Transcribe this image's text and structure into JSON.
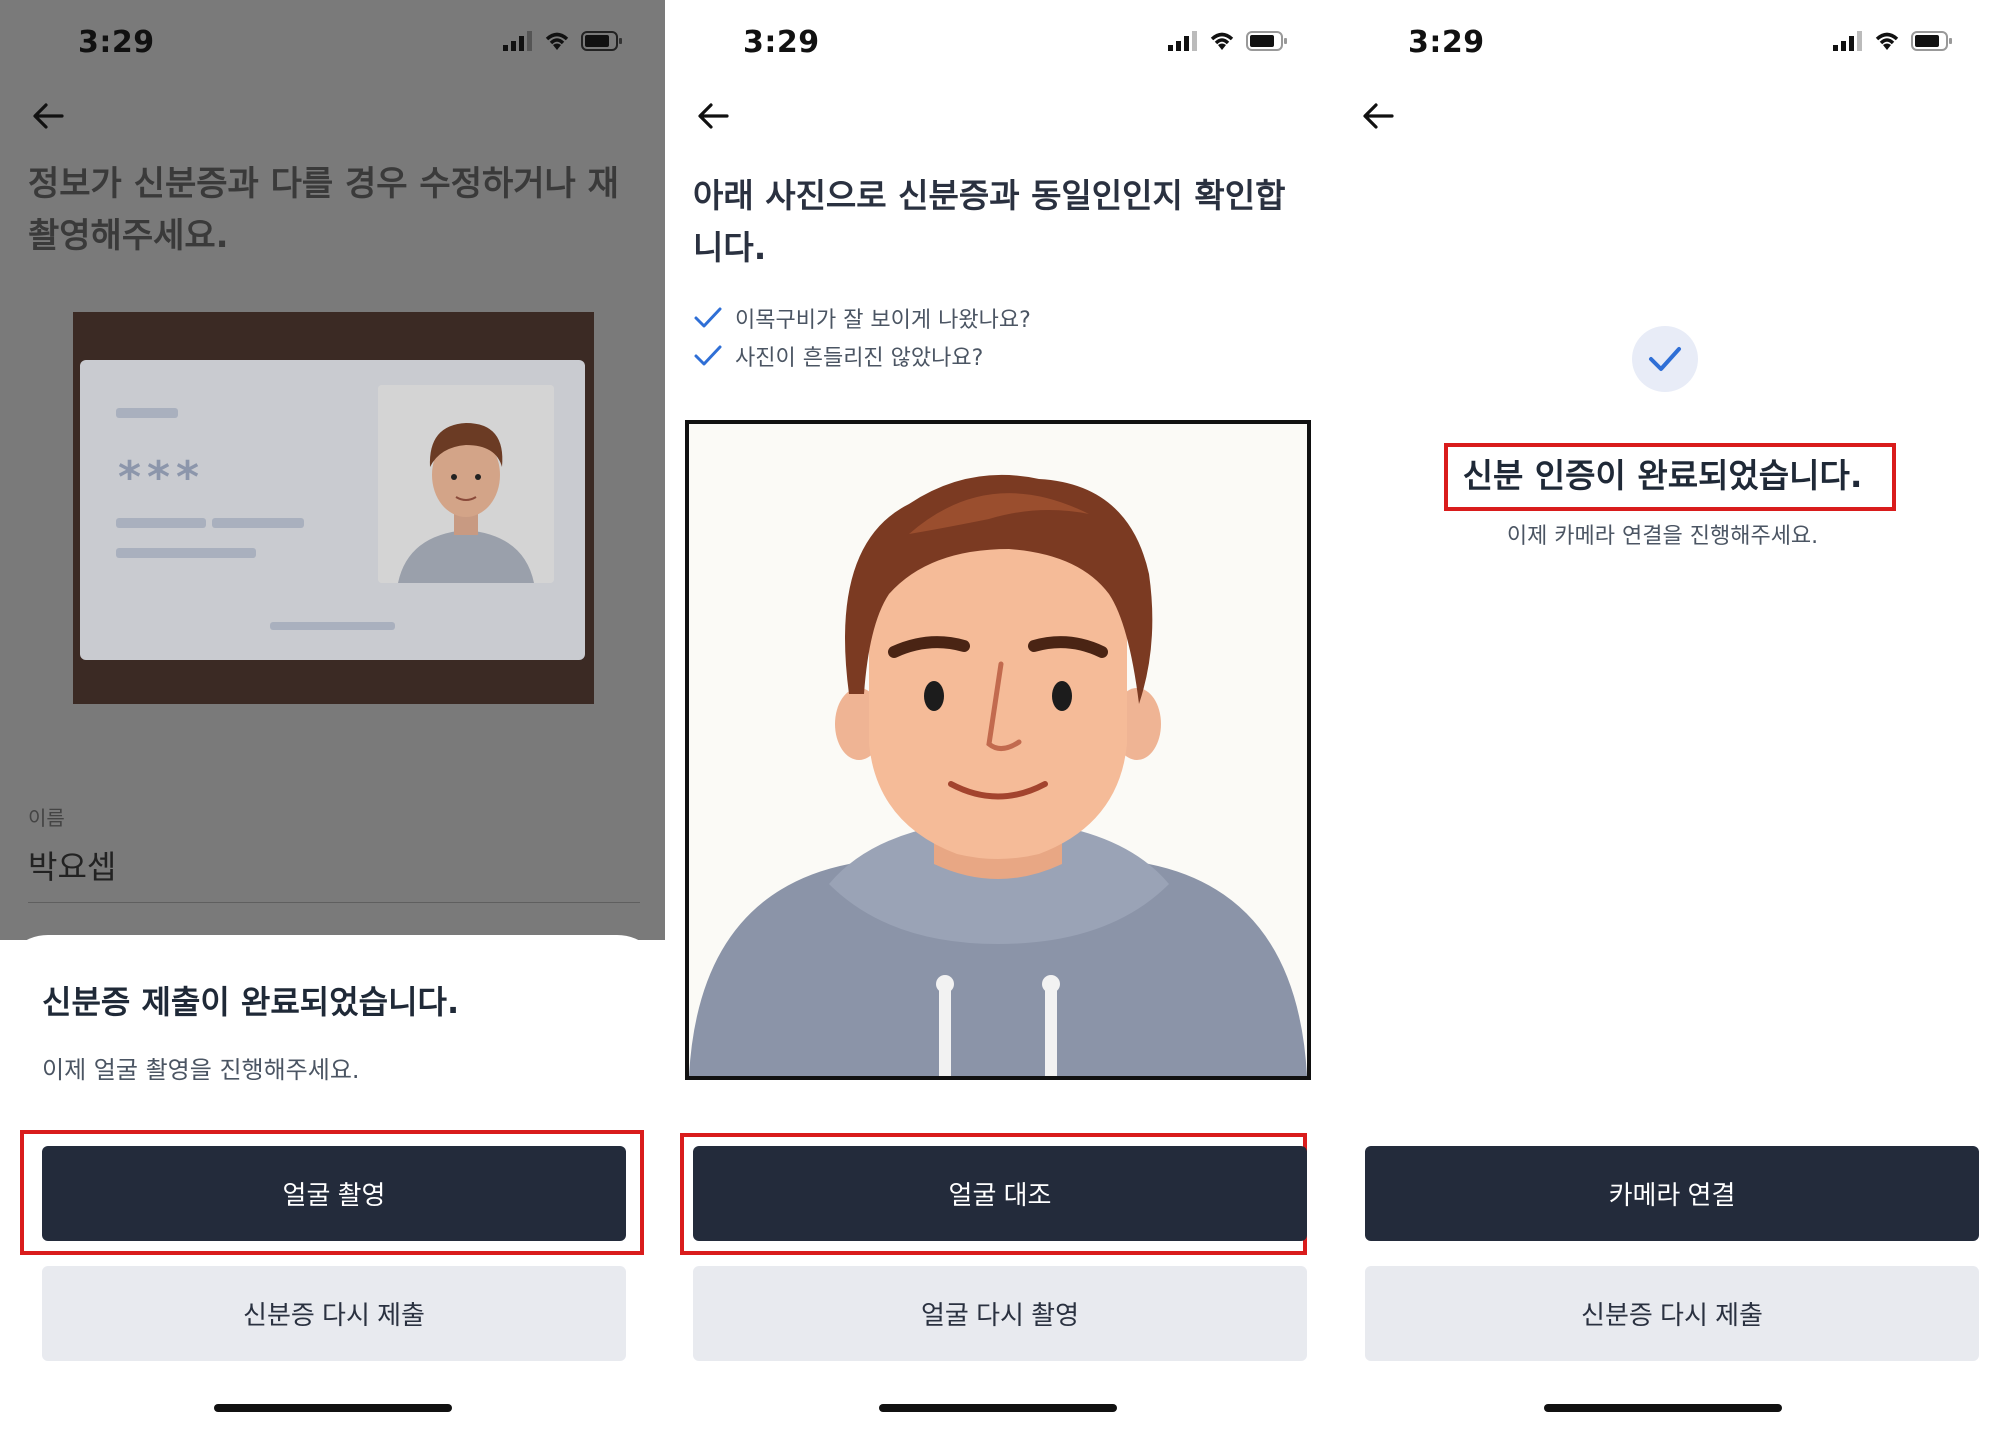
{
  "status": {
    "time": "3:29"
  },
  "screen1": {
    "title": "정보가 신분증과 다를 경우 수정하거나 재촬영해주세요.",
    "id_card_masked": "***",
    "name_label": "이름",
    "name_value": "박요셉",
    "sheet_title": "신분증 제출이 완료되었습니다.",
    "sheet_subtitle": "이제 얼굴 촬영을 진행해주세요.",
    "primary_button": "얼굴 촬영",
    "secondary_button": "신분증 다시 제출"
  },
  "screen2": {
    "title": "아래 사진으로 신분증과 동일인인지 확인합니다.",
    "checklist": [
      "이목구비가 잘 보이게 나왔나요?",
      "사진이 흔들리진 않았나요?"
    ],
    "primary_button": "얼굴 대조",
    "secondary_button": "얼굴 다시 촬영"
  },
  "screen3": {
    "title": "신분 인증이 완료되었습니다.",
    "subtitle": "이제 카메라 연결을 진행해주세요.",
    "primary_button": "카메라 연결",
    "secondary_button": "신분증 다시 제출"
  },
  "colors": {
    "primary": "#232b3b",
    "secondary": "#e8eaef",
    "highlight": "#d91c1c",
    "check": "#2f6fd6"
  }
}
